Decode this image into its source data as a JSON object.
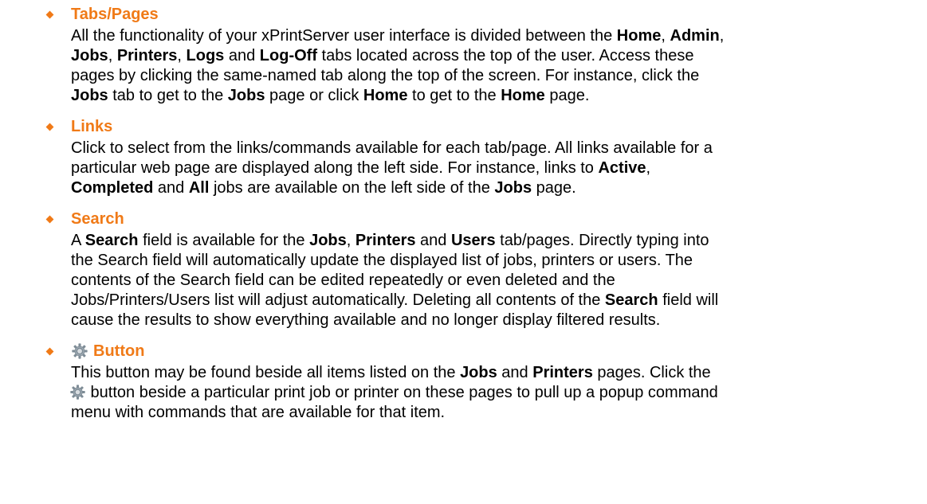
{
  "colors": {
    "heading": "#f07a17",
    "text": "#000000",
    "gear_icon": "#7e8c96"
  },
  "sections": [
    {
      "heading": "Tabs/Pages",
      "lines": [
        [
          {
            "t": "All the functionality of your xPrintServer user interface is divided between the "
          },
          {
            "t": "Home",
            "b": true
          },
          {
            "t": ", "
          },
          {
            "t": "Admin",
            "b": true
          },
          {
            "t": ","
          }
        ],
        [
          {
            "t": "Jobs",
            "b": true
          },
          {
            "t": ", "
          },
          {
            "t": "Printers",
            "b": true
          },
          {
            "t": ", "
          },
          {
            "t": "Logs",
            "b": true
          },
          {
            "t": " and "
          },
          {
            "t": "Log-Off",
            "b": true
          },
          {
            "t": " tabs located across the top of the user.  Access these"
          }
        ],
        [
          {
            "t": "pages by clicking the same-named tab along the top of the screen.  For instance, click the"
          }
        ],
        [
          {
            "t": "Jobs",
            "b": true
          },
          {
            "t": " tab to get to the "
          },
          {
            "t": "Jobs",
            "b": true
          },
          {
            "t": " page or click "
          },
          {
            "t": "Home",
            "b": true
          },
          {
            "t": " to get to the "
          },
          {
            "t": "Home",
            "b": true
          },
          {
            "t": " page."
          }
        ]
      ]
    },
    {
      "heading": "Links",
      "lines": [
        [
          {
            "t": "Click to select from the links/commands available for each tab/page.  All links available for a"
          }
        ],
        [
          {
            "t": "particular web page are displayed along the left side.  For instance, links to "
          },
          {
            "t": "Active",
            "b": true
          },
          {
            "t": ","
          }
        ],
        [
          {
            "t": "Completed",
            "b": true
          },
          {
            "t": " and "
          },
          {
            "t": "All",
            "b": true
          },
          {
            "t": " jobs are available on the left side of the "
          },
          {
            "t": "Jobs",
            "b": true
          },
          {
            "t": " page."
          }
        ]
      ]
    },
    {
      "heading": "Search",
      "lines": [
        [
          {
            "t": "A "
          },
          {
            "t": "Search",
            "b": true
          },
          {
            "t": " field is available for the "
          },
          {
            "t": "Jobs",
            "b": true
          },
          {
            "t": ", "
          },
          {
            "t": "Printers",
            "b": true
          },
          {
            "t": " and "
          },
          {
            "t": "Users",
            "b": true
          },
          {
            "t": " tab/pages. Directly typing into"
          }
        ],
        [
          {
            "t": "the Search field will automatically update the displayed list of jobs, printers or users.  The"
          }
        ],
        [
          {
            "t": "contents of the Search field can be edited repeatedly or even deleted and the"
          }
        ],
        [
          {
            "t": "Jobs/Printers/Users list will adjust automatically.  Deleting all contents of the "
          },
          {
            "t": "Search",
            "b": true
          },
          {
            "t": " field will"
          }
        ],
        [
          {
            "t": "cause the results to show everything available and no longer display filtered results."
          }
        ]
      ]
    },
    {
      "heading": "Button",
      "heading_icon": "gear-icon",
      "lines": [
        [
          {
            "t": "This button may be found beside all items listed on the "
          },
          {
            "t": "Jobs",
            "b": true
          },
          {
            "t": " and "
          },
          {
            "t": "Printers",
            "b": true
          },
          {
            "t": " pages.  Click  the"
          }
        ],
        [
          {
            "icon": "gear-icon"
          },
          {
            "t": " button beside a particular print job or printer on these pages to pull up a popup command"
          }
        ],
        [
          {
            "t": "menu with commands that are available for that item."
          }
        ]
      ]
    }
  ]
}
